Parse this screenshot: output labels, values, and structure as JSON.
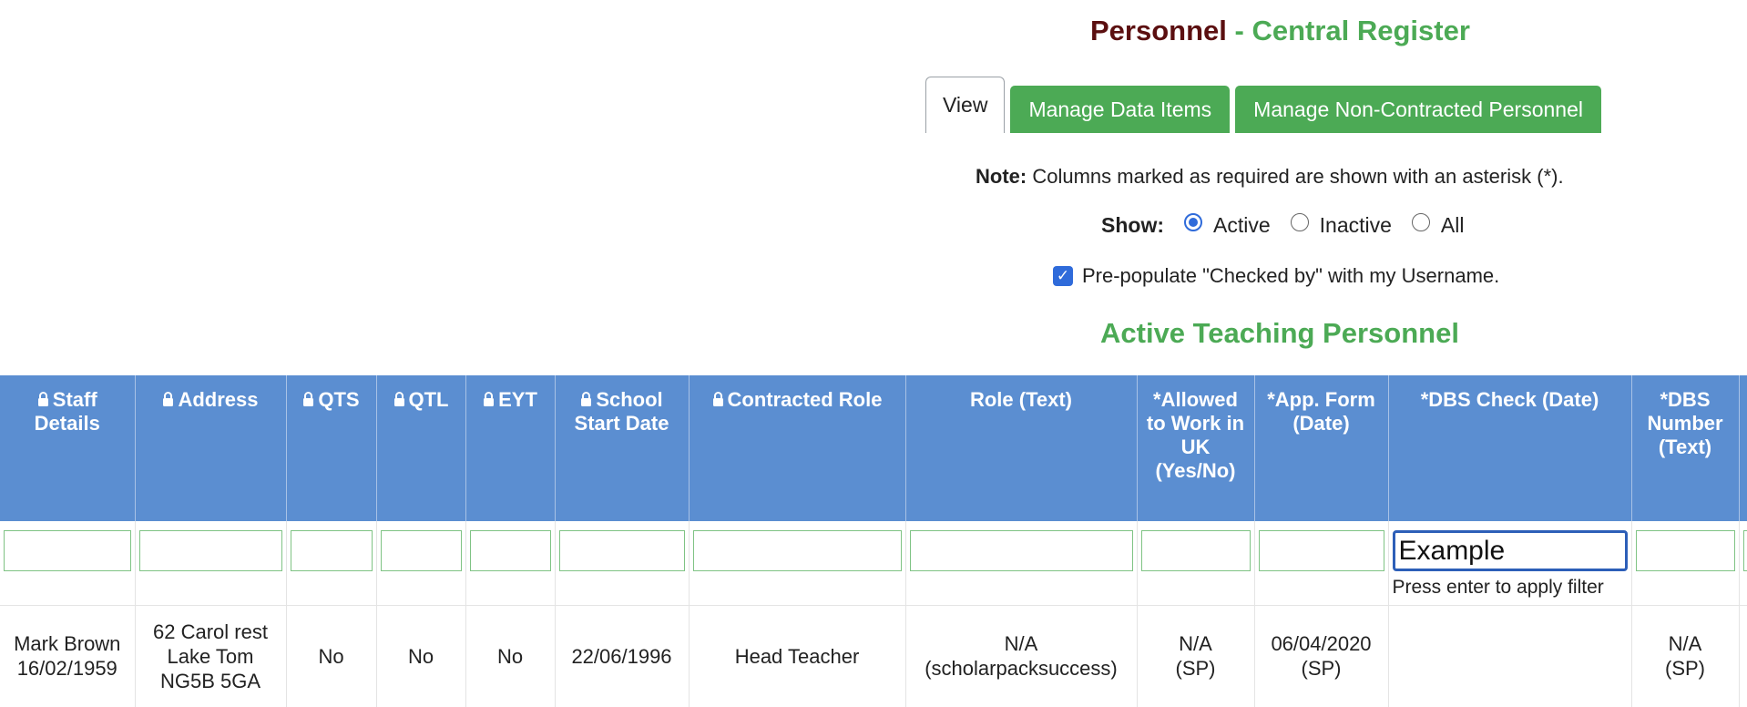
{
  "header": {
    "title_main": "Personnel",
    "title_sub": " - Central Register"
  },
  "tabs": [
    {
      "label": "View",
      "active": true
    },
    {
      "label": "Manage Data Items",
      "active": false
    },
    {
      "label": "Manage Non-Contracted Personnel",
      "active": false
    }
  ],
  "note": {
    "label": "Note:",
    "text": " Columns marked as required are shown with an asterisk (*)."
  },
  "show": {
    "label": "Show:",
    "options": [
      {
        "label": "Active",
        "selected": true
      },
      {
        "label": "Inactive",
        "selected": false
      },
      {
        "label": "All",
        "selected": false
      }
    ]
  },
  "prepopulate": {
    "label": "Pre-populate \"Checked by\" with my Username.",
    "checked": true
  },
  "section_title": "Active Teaching Personnel",
  "table": {
    "columns": [
      {
        "label": "Staff Details",
        "locked": true
      },
      {
        "label": "Address",
        "locked": true
      },
      {
        "label": "QTS",
        "locked": true
      },
      {
        "label": "QTL",
        "locked": true
      },
      {
        "label": "EYT",
        "locked": true
      },
      {
        "label": "School Start Date",
        "locked": true
      },
      {
        "label": "Contracted Role",
        "locked": true
      },
      {
        "label": "Role (Text)",
        "locked": false
      },
      {
        "label": "*Allowed to Work in UK (Yes/No)",
        "locked": false
      },
      {
        "label": "*App. Form (Date)",
        "locked": false
      },
      {
        "label": "*DBS Check (Date)",
        "locked": false
      },
      {
        "label": "*DBS Number (Text)",
        "locked": false
      },
      {
        "label": "",
        "locked": false
      }
    ],
    "filters": [
      "",
      "",
      "",
      "",
      "",
      "",
      "",
      "",
      "",
      "",
      "Example",
      "",
      ""
    ],
    "filter_hint": "Press enter to apply filter",
    "rows": [
      [
        "Mark Brown 16/02/1959",
        "62 Carol rest Lake Tom NG5B 5GA",
        "No",
        "No",
        "No",
        "22/06/1996",
        "Head Teacher",
        "N/A (scholarpacksuccess)",
        "N/A (SP)",
        "06/04/2020 (SP)",
        "",
        "N/A (SP)",
        ""
      ]
    ]
  },
  "colors": {
    "title_dark": "#5b0f10",
    "accent_green": "#4caa55",
    "header_blue": "#5b8ed1",
    "focus_blue": "#2d5fb8"
  }
}
